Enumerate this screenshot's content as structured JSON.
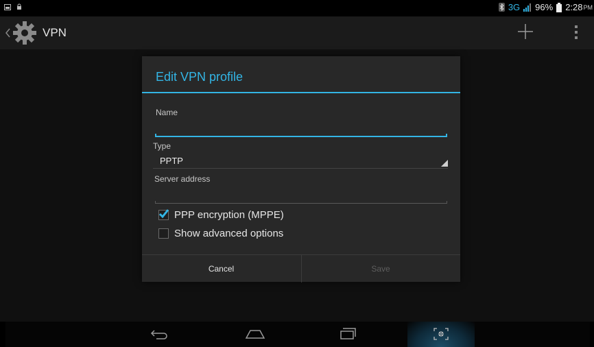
{
  "status_bar": {
    "network": "3G",
    "battery": "96%",
    "time": "2:28",
    "ampm": "PM"
  },
  "action_bar": {
    "title": "VPN"
  },
  "dialog": {
    "title": "Edit VPN profile",
    "name": {
      "label": "Name",
      "value": ""
    },
    "type": {
      "label": "Type",
      "value": "PPTP"
    },
    "server": {
      "label": "Server address",
      "value": ""
    },
    "ppp_encryption": {
      "label": "PPP encryption (MPPE)",
      "checked": true
    },
    "show_advanced": {
      "label": "Show advanced options",
      "checked": false
    },
    "cancel_label": "Cancel",
    "save_label": "Save"
  },
  "colors": {
    "accent": "#33b5e5",
    "dialog_bg": "#282828",
    "background": "#101010"
  }
}
